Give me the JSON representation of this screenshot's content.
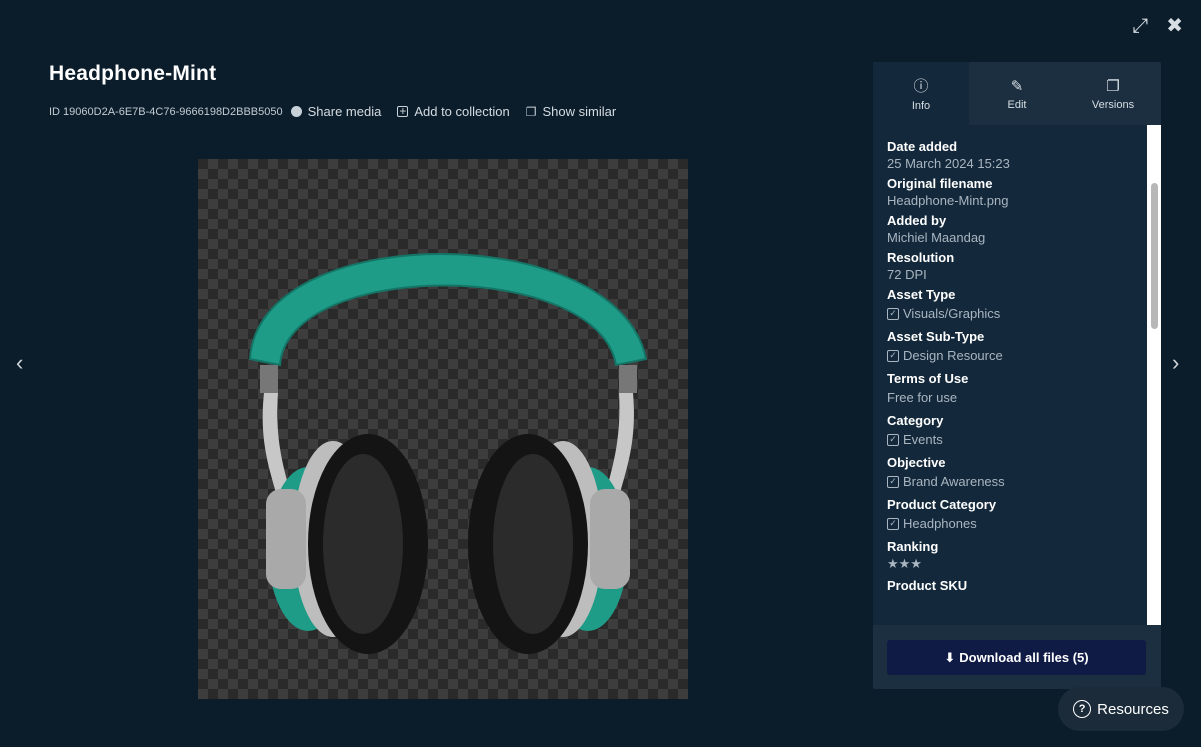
{
  "header": {
    "title": "Headphone-Mint",
    "id_text": "ID 19060D2A-6E7B-4C76-9666198D2BBB5050",
    "actions": {
      "share": "Share media",
      "add_collection": "Add to collection",
      "show_similar": "Show similar"
    }
  },
  "tabs": [
    {
      "label": "Info",
      "icon": "info-icon"
    },
    {
      "label": "Edit",
      "icon": "edit-icon"
    },
    {
      "label": "Versions",
      "icon": "versions-icon"
    }
  ],
  "fields": [
    {
      "label": "Date added",
      "value": "25 March 2024 15:23"
    },
    {
      "label": "Original filename",
      "value": "Headphone-Mint.png"
    },
    {
      "label": "Added by",
      "value": "Michiel Maandag"
    },
    {
      "label": "Resolution",
      "value": "72 DPI"
    },
    {
      "label": "Asset Type",
      "value": "Visuals/Graphics"
    },
    {
      "label": "Asset Sub-Type",
      "value": "Design Resource"
    },
    {
      "label": "Terms of Use",
      "value": "Free for use"
    },
    {
      "label": "Category",
      "value": "Events"
    },
    {
      "label": "Objective",
      "value": "Brand Awareness"
    },
    {
      "label": "Product Category",
      "value": "Headphones"
    },
    {
      "label": "Ranking",
      "value": "★★★"
    },
    {
      "label": "Product SKU",
      "value": ""
    }
  ],
  "download_label": "Download all files (5)",
  "resources_label": "Resources",
  "colors": {
    "accent_mint": "#1e9c88",
    "panel": "#1b2f41",
    "background": "#0b1d2b"
  }
}
